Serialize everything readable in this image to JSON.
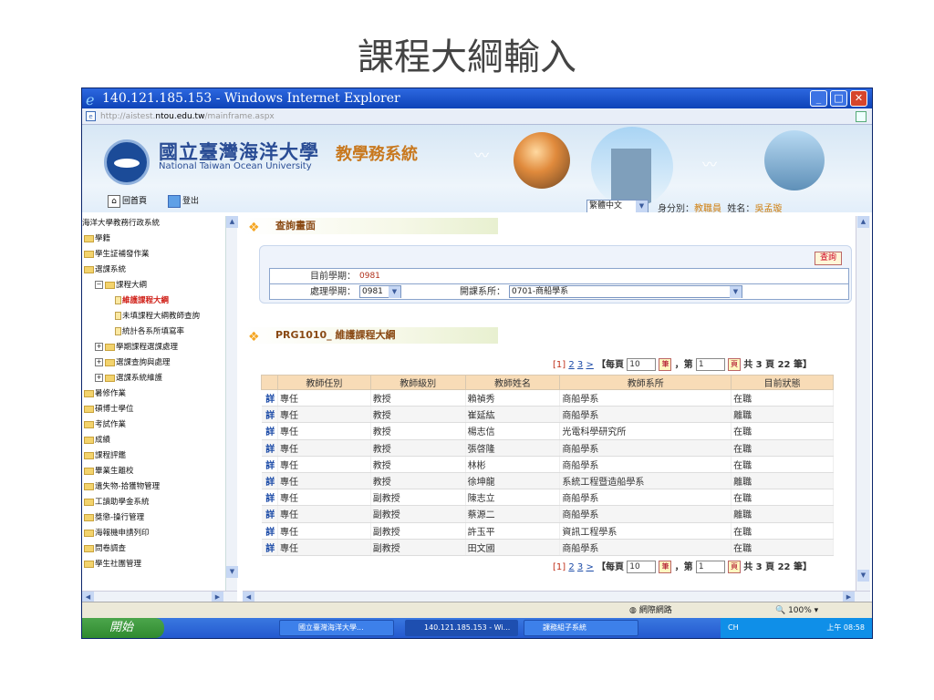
{
  "slide_title": "課程大綱輸入",
  "window": {
    "title": "140.121.185.153 - Windows Internet Explorer"
  },
  "address": {
    "prefix": "http://aistest.",
    "host": "ntou.edu.tw",
    "path": "/mainframe.aspx"
  },
  "banner": {
    "university_cn": "國立臺灣海洋大學",
    "university_en": "National Taiwan Ocean University",
    "system_name": "教學務系統",
    "home_label": "回首頁",
    "logout_label": "登出",
    "language": "繁體中文",
    "identity_label": "身分別：",
    "identity_value": "教職員",
    "name_label": "姓名：",
    "name_value": "吳孟璇"
  },
  "tree": {
    "root": "海洋大學教務行政系統",
    "items": [
      "學籍",
      "學生証補發作業",
      "選課系統",
      "課程大綱",
      "維護課程大綱",
      "未填課程大綱教師查詢",
      "統計各系所填寫率",
      "學期課程選課處理",
      "選課查詢與處理",
      "選課系統維護",
      "暑修作業",
      "碩博士學位",
      "考試作業",
      "成績",
      "課程評鑑",
      "畢業生離校",
      "遺失物-拾獲物管理",
      "工讀助學金系統",
      "獎懲-操行管理",
      "海報機申請列印",
      "問卷調查",
      "學生社團管理"
    ]
  },
  "query": {
    "section_title": "查詢畫面",
    "button": "查詢",
    "current_term_label": "目前學期：",
    "current_term_value": "0981",
    "process_term_label": "處理學期：",
    "process_term_value": "0981",
    "dept_label": "開課系所：",
    "dept_value": "0701-商船學系"
  },
  "list": {
    "section_title": "PRG1010_ 維護課程大綱",
    "pager": {
      "p1": "[1]",
      "p2": "2",
      "p3": "3",
      "next": ">",
      "per_page_prefix": "【每頁",
      "per_page": "10",
      "per_page_unit": "筆",
      "page_prefix": "，第",
      "page": "1",
      "page_unit": "頁",
      "summary": "共 3 頁 22 筆】"
    },
    "columns": [
      "教師任別",
      "教師級別",
      "教師姓名",
      "教師系所",
      "目前狀態"
    ],
    "detail_label": "詳",
    "rows": [
      [
        "專任",
        "教授",
        "賴禎秀",
        "商船學系",
        "在職"
      ],
      [
        "專任",
        "教授",
        "崔延紘",
        "商船學系",
        "離職"
      ],
      [
        "專任",
        "教授",
        "楊志信",
        "光電科學研究所",
        "在職"
      ],
      [
        "專任",
        "教授",
        "張啓隆",
        "商船學系",
        "在職"
      ],
      [
        "專任",
        "教授",
        "林彬",
        "商船學系",
        "在職"
      ],
      [
        "專任",
        "教授",
        "徐坤龍",
        "系統工程暨造船學系",
        "離職"
      ],
      [
        "專任",
        "副教授",
        "陳志立",
        "商船學系",
        "在職"
      ],
      [
        "專任",
        "副教授",
        "蔡源二",
        "商船學系",
        "離職"
      ],
      [
        "專任",
        "副教授",
        "許玉平",
        "資訊工程學系",
        "在職"
      ],
      [
        "專任",
        "副教授",
        "田文國",
        "商船學系",
        "在職"
      ]
    ]
  },
  "statusbar": {
    "zone": "網際網路",
    "zoom": "100%"
  },
  "taskbar": {
    "start": "開始",
    "tasks": [
      "國立臺灣海洋大學...",
      "140.121.185.153 - Wi...",
      "課務組子系統"
    ],
    "lang": "CH",
    "time": "上午 08:58"
  }
}
